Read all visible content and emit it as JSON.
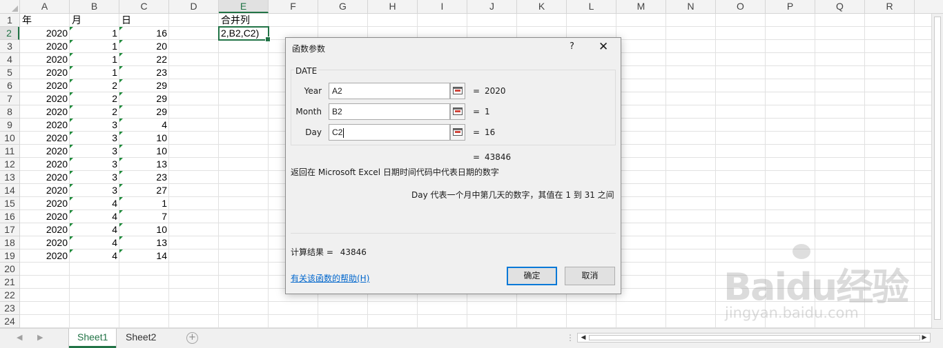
{
  "spreadsheet": {
    "columns": [
      "A",
      "B",
      "C",
      "D",
      "E",
      "F",
      "G",
      "H",
      "I",
      "J",
      "K",
      "L",
      "M",
      "N",
      "O",
      "P",
      "Q",
      "R"
    ],
    "active_column": "E",
    "rows": [
      "1",
      "2",
      "3",
      "4",
      "5",
      "6",
      "7",
      "8",
      "9",
      "10",
      "11",
      "12",
      "13",
      "14",
      "15",
      "16",
      "17",
      "18",
      "19",
      "20",
      "21",
      "22",
      "23",
      "24"
    ],
    "active_row": "2",
    "headers": {
      "A": "年",
      "B": "月",
      "C": "日",
      "E": "合并列"
    },
    "data": [
      [
        "2020",
        "1",
        "16"
      ],
      [
        "2020",
        "1",
        "20"
      ],
      [
        "2020",
        "1",
        "22"
      ],
      [
        "2020",
        "1",
        "23"
      ],
      [
        "2020",
        "2",
        "29"
      ],
      [
        "2020",
        "2",
        "29"
      ],
      [
        "2020",
        "2",
        "29"
      ],
      [
        "2020",
        "3",
        "4"
      ],
      [
        "2020",
        "3",
        "10"
      ],
      [
        "2020",
        "3",
        "10"
      ],
      [
        "2020",
        "3",
        "13"
      ],
      [
        "2020",
        "3",
        "23"
      ],
      [
        "2020",
        "3",
        "27"
      ],
      [
        "2020",
        "4",
        "1"
      ],
      [
        "2020",
        "4",
        "7"
      ],
      [
        "2020",
        "4",
        "10"
      ],
      [
        "2020",
        "4",
        "13"
      ],
      [
        "2020",
        "4",
        "14"
      ]
    ],
    "selected_cell_text": "2,B2,C2)"
  },
  "sheet_tabs": [
    {
      "label": "Sheet1",
      "active": true
    },
    {
      "label": "Sheet2",
      "active": false
    }
  ],
  "dialog": {
    "title": "函数参数",
    "help_label": "?",
    "close_label": "✕",
    "function_name": "DATE",
    "args": [
      {
        "label": "Year",
        "value": "A2",
        "result": "2020"
      },
      {
        "label": "Month",
        "value": "B2",
        "result": "1"
      },
      {
        "label": "Day",
        "value": "C2",
        "result": "16"
      }
    ],
    "equals": "=",
    "formula_result": "43846",
    "description": "返回在 Microsoft Excel 日期时间代码中代表日期的数字",
    "param_description": "Day  代表一个月中第几天的数字，其值在 1 到 31 之间",
    "calc_label": "计算结果 =",
    "calc_value": "43846",
    "help_link": "有关该函数的帮助(H)",
    "ok_label": "确定",
    "cancel_label": "取消"
  },
  "watermark": {
    "logo": "Baidu经验",
    "sub": "jingyan.baidu.com"
  },
  "colors": {
    "accent": "#217346",
    "link": "#0066cc",
    "focus": "#0078d7"
  }
}
